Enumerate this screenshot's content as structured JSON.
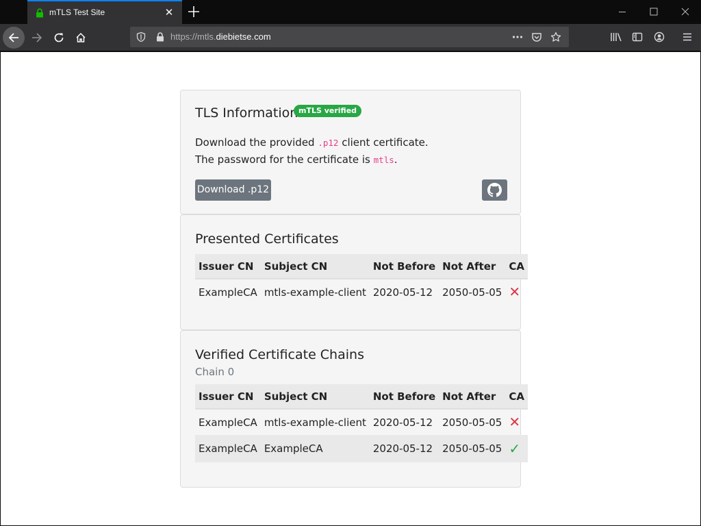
{
  "browser": {
    "tab_title": "mTLS Test Site",
    "tab_close": "✕",
    "url_prefix": "https://mtls.",
    "url_host": "diebietse.com"
  },
  "tls_card": {
    "title": "TLS Information",
    "badge": "mTLS verified",
    "line1_before": "Download the provided ",
    "line1_code": ".p12",
    "line1_after": " client certificate.",
    "line2_before": "The password for the certificate is ",
    "line2_code": "mtls",
    "line2_after": ".",
    "download_label": "Download .p12"
  },
  "presented": {
    "title": "Presented Certificates",
    "headers": [
      "Issuer CN",
      "Subject CN",
      "Not Before",
      "Not After",
      "CA"
    ],
    "rows": [
      {
        "issuer": "ExampleCA",
        "subject": "mtls-example-client",
        "not_before": "2020-05-12",
        "not_after": "2050-05-05",
        "ca": "✕"
      }
    ]
  },
  "verified": {
    "title": "Verified Certificate Chains",
    "chain_label": "Chain 0",
    "headers": [
      "Issuer CN",
      "Subject CN",
      "Not Before",
      "Not After",
      "CA"
    ],
    "rows": [
      {
        "issuer": "ExampleCA",
        "subject": "mtls-example-client",
        "not_before": "2020-05-12",
        "not_after": "2050-05-05",
        "ca": "✕"
      },
      {
        "issuer": "ExampleCA",
        "subject": "ExampleCA",
        "not_before": "2020-05-12",
        "not_after": "2050-05-05",
        "ca": "✓"
      }
    ]
  },
  "colors": {
    "badge_green": "#28a745",
    "cross_red": "#dc3545",
    "button_gray": "#6c757d",
    "tab_accent": "#0a84ff"
  },
  "icons": [
    "lock-icon",
    "close-icon",
    "plus-icon",
    "minimize-icon",
    "maximize-icon",
    "back-icon",
    "forward-icon",
    "reload-icon",
    "home-icon",
    "shield-icon",
    "more-icon",
    "pocket-icon",
    "star-icon",
    "library-icon",
    "sidebar-icon",
    "account-icon",
    "menu-icon",
    "github-icon"
  ]
}
